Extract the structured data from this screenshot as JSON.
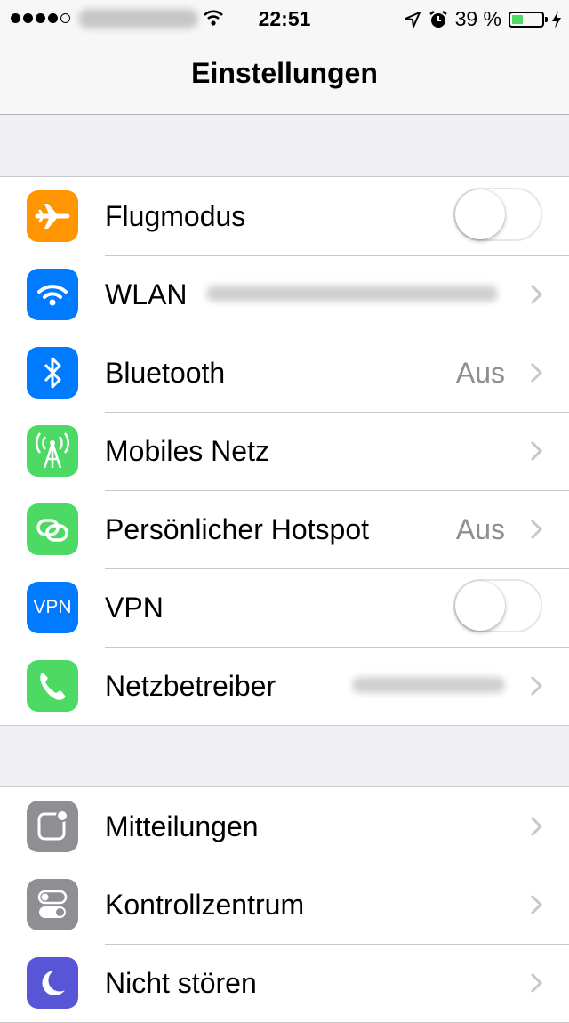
{
  "status_bar": {
    "time": "22:51",
    "battery_percent": "39 %",
    "battery_level": 0.39,
    "signal_bars_filled": 4,
    "signal_bars_total": 5,
    "icons": [
      "signal-dots-icon",
      "wifi-icon",
      "location-arrow-icon",
      "alarm-clock-icon",
      "battery-icon",
      "charging-bolt-icon"
    ]
  },
  "nav": {
    "title": "Einstellungen"
  },
  "groups": [
    {
      "rows": [
        {
          "label": "Flugmodus",
          "icon": "airplane-icon",
          "icon_color": "#ff9500",
          "accessory": "toggle",
          "toggle_on": false
        },
        {
          "label": "WLAN",
          "icon": "wifi-icon",
          "icon_color": "#007aff",
          "accessory": "chevron"
        },
        {
          "label": "Bluetooth",
          "icon": "bluetooth-icon",
          "icon_color": "#007aff",
          "value": "Aus",
          "accessory": "chevron"
        },
        {
          "label": "Mobiles Netz",
          "icon": "antenna-icon",
          "icon_color": "#4cd964",
          "accessory": "chevron"
        },
        {
          "label": "Persönlicher Hotspot",
          "icon": "hotspot-icon",
          "icon_color": "#4cd964",
          "value": "Aus",
          "accessory": "chevron"
        },
        {
          "label": "VPN",
          "icon": "vpn-icon",
          "icon_text": "VPN",
          "icon_color": "#007aff",
          "accessory": "toggle",
          "toggle_on": false
        },
        {
          "label": "Netzbetreiber",
          "icon": "phone-icon",
          "icon_color": "#4cd964",
          "accessory": "chevron"
        }
      ]
    },
    {
      "rows": [
        {
          "label": "Mitteilungen",
          "icon": "notifications-icon",
          "icon_color": "#8e8e93",
          "accessory": "chevron"
        },
        {
          "label": "Kontrollzentrum",
          "icon": "control-center-icon",
          "icon_color": "#8e8e93",
          "accessory": "chevron"
        },
        {
          "label": "Nicht stören",
          "icon": "moon-icon",
          "icon_color": "#5856d6",
          "accessory": "chevron"
        }
      ]
    }
  ]
}
